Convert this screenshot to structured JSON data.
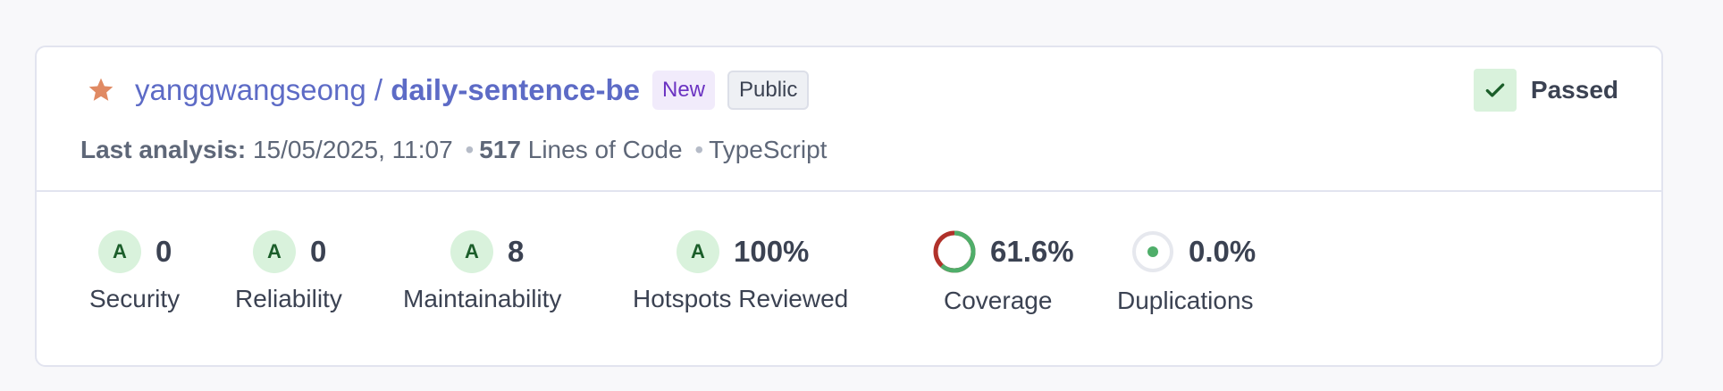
{
  "project": {
    "owner": "yanggwangseong",
    "separator": " / ",
    "name": "daily-sentence-be",
    "badges": {
      "new": "New",
      "public": "Public"
    },
    "status": "Passed",
    "icons": {
      "favorite": "star-icon",
      "status": "check-icon"
    }
  },
  "meta": {
    "analysis_label": "Last analysis:",
    "analysis_date": "15/05/2025, 11:07",
    "loc_value": "517",
    "loc_label": "Lines of Code",
    "language": "TypeScript",
    "dot": "•"
  },
  "metrics": {
    "security": {
      "rating": "A",
      "value": "0",
      "label": "Security"
    },
    "reliability": {
      "rating": "A",
      "value": "0",
      "label": "Reliability"
    },
    "maintainability": {
      "rating": "A",
      "value": "8",
      "label": "Maintainability"
    },
    "hotspots": {
      "rating": "A",
      "value": "100%",
      "label": "Hotspots Reviewed"
    },
    "coverage": {
      "value": "61.6%",
      "label": "Coverage",
      "percent": 61.6
    },
    "duplications": {
      "value": "0.0%",
      "label": "Duplications",
      "percent": 0.0
    }
  },
  "colors": {
    "link": "#5d6bc6",
    "star": "#e08a63",
    "rating_bg": "#d9f2dc",
    "rating_text": "#1b5e2a",
    "coverage_covered": "#4fae6a",
    "coverage_uncovered": "#b0312a",
    "duplication_dot": "#4fae6a"
  }
}
